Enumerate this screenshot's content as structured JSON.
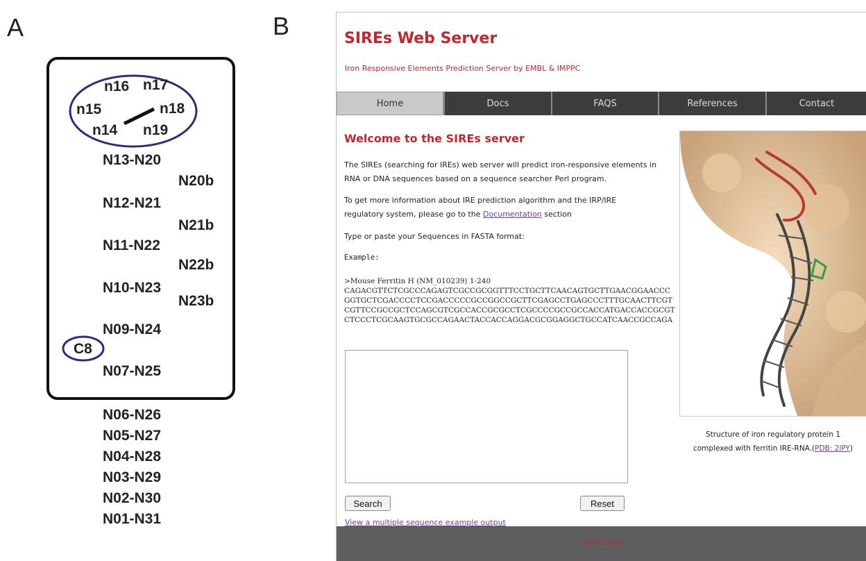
{
  "panel_labels": {
    "a": "A",
    "b": "B"
  },
  "ire": {
    "loop": {
      "n16": "n16",
      "n17": "n17",
      "n15": "n15",
      "n18": "n18",
      "n14": "n14",
      "n19": "n19"
    },
    "inside": [
      "N13-N20",
      "N20b",
      "N12-N21",
      "N21b",
      "N11-N22",
      "N22b",
      "N10-N23",
      "N23b",
      "N09-N24",
      "C8",
      "N07-N25"
    ],
    "outside": [
      "N06-N26",
      "N05-N27",
      "N04-N28",
      "N03-N29",
      "N02-N30",
      "N01-N31"
    ],
    "colors": {
      "loop_circle": "#2e2a82",
      "box": "#111111"
    }
  },
  "site": {
    "title": "SIREs Web Server",
    "subtitle": "Iron Responsive Elements Prediction Server by EMBL & IMPPC",
    "nav": [
      "Home",
      "Docs",
      "FAQS",
      "References",
      "Contact"
    ],
    "active_tab": "Home",
    "welcome": "Welcome to the SIREs server",
    "intro_line1": "The SIREs (searching for IREs) web server will predict iron-responsive elements in",
    "intro_line2": "RNA or DNA sequences based on a sequence searcher Perl program.",
    "info_line1": "To get more information about IRE prediction algorithm and the IRP/IRE",
    "info_line2_pre": "regulatory system, please go to the ",
    "info_link": "Documentation",
    "info_line2_post": " section",
    "fasta_prompt": "Type or paste your Sequences in FASTA format:",
    "example_label": "Example:",
    "example_header": ">Mouse Ferritin H (NM_010239) 1-240",
    "example_seq": [
      "CAGACGTTCTCGCCCAGAGTCGCCGCGGTTTCCTGCTTCAACAGTGCTTGAACGGAACCC",
      "GGTGCTCGACCCCTCCGACCCCCGCCGGCCGCTTCGAGCCTGAGCCCTTTGCAACTTCGT",
      "CGTTCCGCCGCTCCAGCGTCGCCACCGCGCCTCGCCCCGCCGCCACCATGACCACCGCGT",
      "CTCCCTCGCAAGTGCGCCAGAACTACCACCAGGACGCGGAGGCTGCCATCAACCGCCAGA"
    ],
    "textarea_value": "",
    "search_label": "Search",
    "reset_label": "Reset",
    "example_link": "View a multiple sequence example output",
    "caption_line1": "Structure of iron regulatory protein 1",
    "caption_line2_pre": "complexed with ferritin IRE-RNA.(",
    "caption_link": "PDB: 2IPY",
    "caption_line2_post": ")",
    "footer": "@IMPPC 2009",
    "colors": {
      "accent": "#c0282d",
      "nav_bg": "#3c3c3c",
      "nav_active": "#c9c9c9",
      "link": "#6a3d9a",
      "footer_bg": "#5e5e5e"
    }
  }
}
